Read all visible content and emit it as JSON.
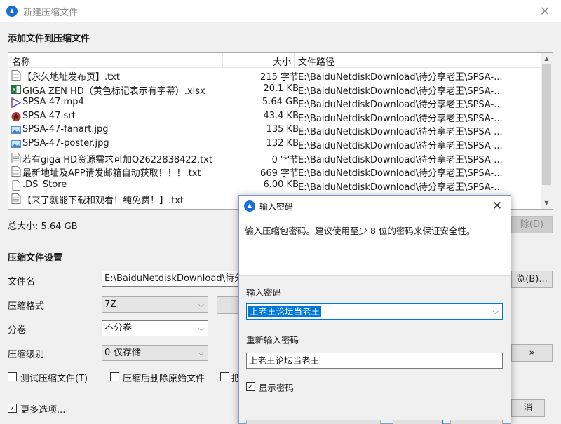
{
  "window": {
    "title": "新建压缩文件"
  },
  "add_files": {
    "heading": "添加文件到压缩文件",
    "columns": {
      "name": "名称",
      "size": "大小",
      "path": "文件路径"
    },
    "files": [
      {
        "name": "【永久地址发布页】.txt",
        "size": "215 字节",
        "path": "E:\\BaiduNetdiskDownload\\待分享老王\\SPSA-...",
        "icon": "text-file-icon"
      },
      {
        "name": "GIGA ZEN HD（黄色标记表示有字幕）.xlsx",
        "size": "20.1 KB",
        "path": "E:\\BaiduNetdiskDownload\\待分享老王\\SPSA-...",
        "icon": "excel-file-icon"
      },
      {
        "name": "SPSA-47.mp4",
        "size": "5.64 GB",
        "path": "E:\\BaiduNetdiskDownload\\待分享老王\\SPSA-...",
        "icon": "video-file-icon"
      },
      {
        "name": "SPSA-47.srt",
        "size": "43.4 KB",
        "path": "E:\\BaiduNetdiskDownload\\待分享老王\\SPSA-...",
        "icon": "subtitle-file-icon"
      },
      {
        "name": "SPSA-47-fanart.jpg",
        "size": "135 KB",
        "path": "E:\\BaiduNetdiskDownload\\待分享老王\\SPSA-...",
        "icon": "image-file-icon"
      },
      {
        "name": "SPSA-47-poster.jpg",
        "size": "132 KB",
        "path": "E:\\BaiduNetdiskDownload\\待分享老王\\SPSA-...",
        "icon": "image-file-icon"
      },
      {
        "name": "若有giga HD资源需求可加Q2622838422.txt",
        "size": "0 字节",
        "path": "E:\\BaiduNetdiskDownload\\待分享老王\\SPSA-...",
        "icon": "text-file-icon"
      },
      {
        "name": "最新地址及APP请发邮箱自动获取！！！.txt",
        "size": "669 字节",
        "path": "E:\\BaiduNetdiskDownload\\待分享老王\\SPSA-...",
        "icon": "text-file-icon"
      },
      {
        "name": ".DS_Store",
        "size": "6.00 KB",
        "path": "E:\\BaiduNetdiskDownload\\待分享老王\\SPSA-...",
        "icon": "blank-file-icon"
      },
      {
        "name": "【来了就能下载和观看！纯免费！】.txt",
        "size": "",
        "path": "",
        "icon": "text-file-icon"
      }
    ],
    "total_size": "总大小: 5.64 GB",
    "delete_button": "除(D)"
  },
  "settings": {
    "heading": "压缩文件设置",
    "filename_label": "文件名",
    "filename_value": "E:\\BaiduNetdiskDownload\\待分",
    "browse_button": "览(B)...",
    "format_label": "压缩格式",
    "format_value": "7Z",
    "split_label": "分卷",
    "split_value": "不分卷",
    "level_label": "压缩级别",
    "level_value": "0-仅存储",
    "more_button": "»",
    "test_checkbox": "测试压缩文件(T)",
    "delete_after_checkbox": "压缩后删除原始文件",
    "third_checkbox": "把",
    "more_options_checkbox": "更多选项...",
    "cancel_button": "消"
  },
  "dialog": {
    "title": "输入密码",
    "info": "输入压缩包密码。建议使用至少 8 位的密码来保证安全性。",
    "password_label": "输入密码",
    "password_value": "上老王论坛当老王",
    "confirm_label": "重新输入密码",
    "confirm_value": "上老王论坛当老王",
    "show_password": "显示密码"
  }
}
